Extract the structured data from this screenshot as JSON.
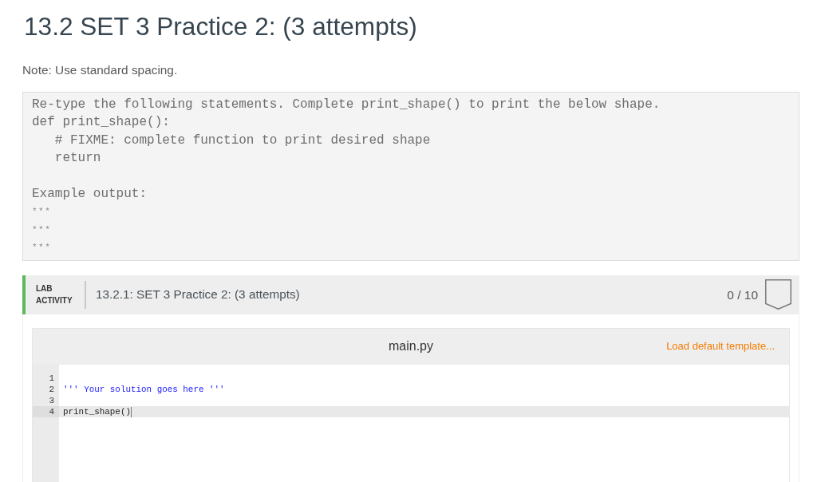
{
  "title": "13.2 SET 3 Practice 2: (3 attempts)",
  "note": "Note: Use standard spacing.",
  "instructions": {
    "lines": [
      "Re-type the following statements. Complete print_shape() to print the below shape.",
      "def print_shape():",
      "   # FIXME: complete function to print desired shape",
      "   return"
    ],
    "example_label": "Example output:",
    "example_lines": [
      "***",
      "***",
      "***"
    ]
  },
  "lab_activity": {
    "label": "LAB ACTIVITY",
    "title": "13.2.1: SET 3 Practice 2: (3 attempts)",
    "score": "0 / 10",
    "editor": {
      "filename": "main.py",
      "template_link": "Load default template...",
      "lines": [
        {
          "number": "1",
          "kind": "blank",
          "active": false
        },
        {
          "number": "2",
          "kind": "string",
          "text": "''' Your solution goes here '''",
          "active": false
        },
        {
          "number": "3",
          "kind": "blank",
          "active": false
        },
        {
          "number": "4",
          "kind": "code",
          "text": "print_shape()",
          "active": true
        }
      ]
    }
  }
}
